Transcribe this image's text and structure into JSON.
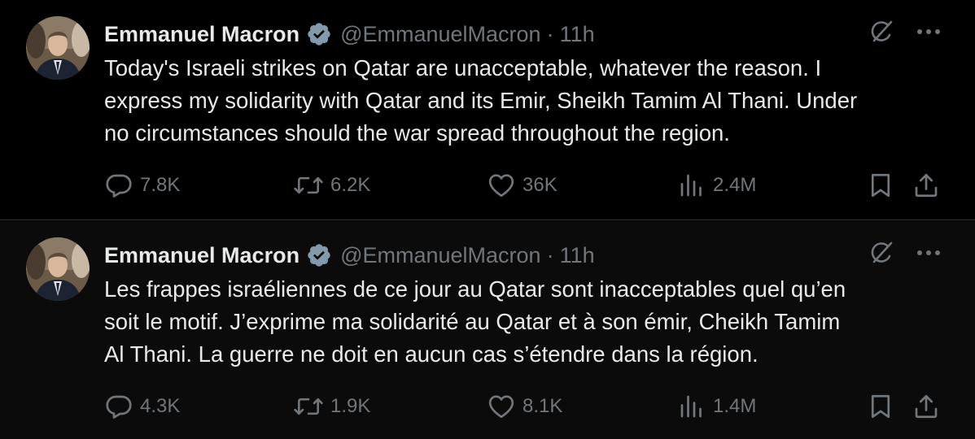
{
  "tweets": [
    {
      "author_name": "Emmanuel Macron",
      "handle": "@EmmanuelMacron",
      "separator": "·",
      "time": "11h",
      "lines": [
        "Today's Israeli strikes on Qatar are unacceptable, whatever the reason. I",
        "express my solidarity with Qatar and its Emir, Sheikh Tamim Al Thani. Under",
        "no circumstances should the war spread throughout the region."
      ],
      "replies": "7.8K",
      "reposts": "6.2K",
      "likes": "36K",
      "views": "2.4M"
    },
    {
      "author_name": "Emmanuel Macron",
      "handle": "@EmmanuelMacron",
      "separator": "·",
      "time": "11h",
      "lines": [
        "Les frappes israéliennes de ce jour au Qatar sont inacceptables quel qu’en",
        "soit le motif. J’exprime ma solidarité au Qatar et à son émir, Cheikh Tamim",
        "Al Thani. La guerre ne doit en aucun cas s’étendre dans la région."
      ],
      "replies": "4.3K",
      "reposts": "1.9K",
      "likes": "8.1K",
      "views": "1.4M"
    }
  ],
  "icons": {
    "verified": "verified-badge-icon",
    "grok": "grok-icon",
    "more": "more-options-icon",
    "reply": "reply-icon",
    "repost": "repost-icon",
    "like": "like-icon",
    "views": "views-icon",
    "bookmark": "bookmark-icon",
    "share": "share-icon"
  },
  "colors": {
    "background": "#000000",
    "text": "#e7e9ea",
    "muted": "#71767b",
    "divider": "#2f3336"
  }
}
